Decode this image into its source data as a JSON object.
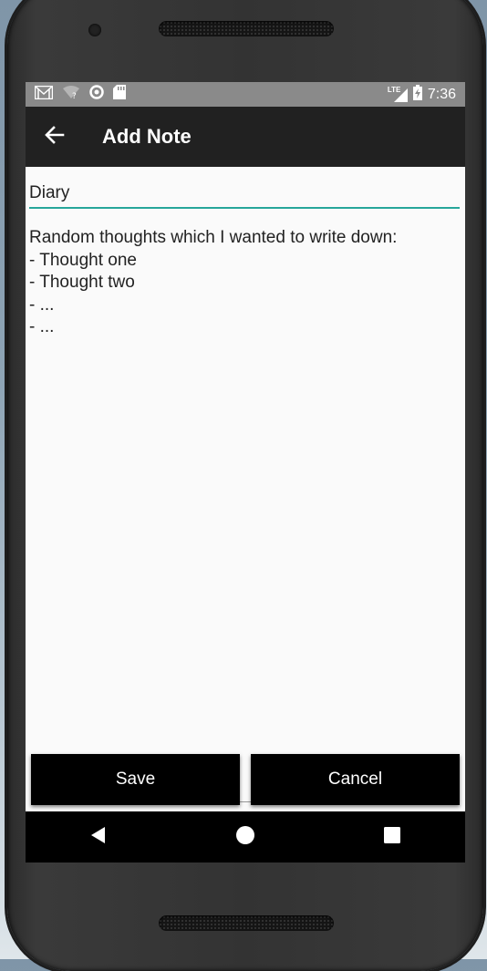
{
  "status_bar": {
    "time": "7:36",
    "network_label": "LTE",
    "icons": [
      "gmail-icon",
      "wifi-question-icon",
      "sync-circle-icon",
      "sd-card-icon",
      "signal-icon",
      "battery-charging-icon"
    ]
  },
  "app_bar": {
    "title": "Add Note",
    "back_icon": "arrow-left-icon"
  },
  "note": {
    "title_value": "Diary",
    "body_value": "Random thoughts which I wanted to write down:\n- Thought one\n- Thought two\n- ...\n- ..."
  },
  "actions": {
    "save_label": "Save",
    "cancel_label": "Cancel"
  },
  "nav_bar": {
    "icons": [
      "back-triangle-icon",
      "home-circle-icon",
      "recents-square-icon"
    ]
  },
  "colors": {
    "accent": "#26a69a",
    "app_bar": "#212121",
    "status_bar": "#8a8a8a",
    "buttons": "#000000"
  }
}
